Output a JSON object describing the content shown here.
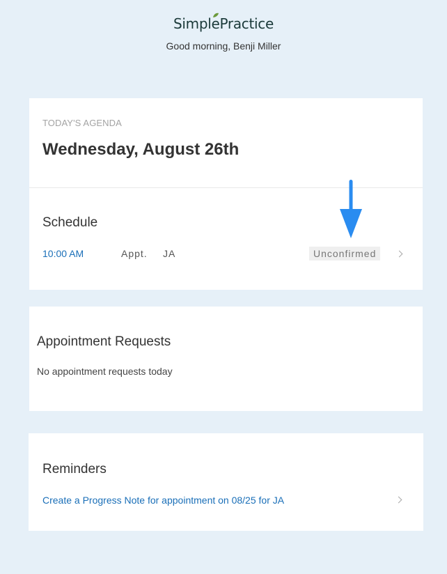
{
  "header": {
    "brand": "SimplePractice",
    "greeting": "Good morning, Benji Miller"
  },
  "agenda": {
    "label": "TODAY'S AGENDA",
    "date": "Wednesday, August 26th",
    "schedule_title": "Schedule",
    "appointment": {
      "time": "10:00 AM",
      "type": "Appt.",
      "client": "JA",
      "status": "Unconfirmed"
    }
  },
  "requests": {
    "title": "Appointment Requests",
    "empty": "No appointment requests today"
  },
  "reminders": {
    "title": "Reminders",
    "item": "Create a Progress Note for appointment on 08/25 for JA"
  },
  "colors": {
    "background": "#e6f0f8",
    "link": "#1a6fb8",
    "arrow": "#2a8cf0",
    "brand": "#1b3a3a",
    "leaf": "#6c9a3c"
  },
  "icons": {
    "brand_leaf": "leaf-icon",
    "annotation": "arrow-down-icon",
    "row_chevron": "chevron-right-icon"
  }
}
